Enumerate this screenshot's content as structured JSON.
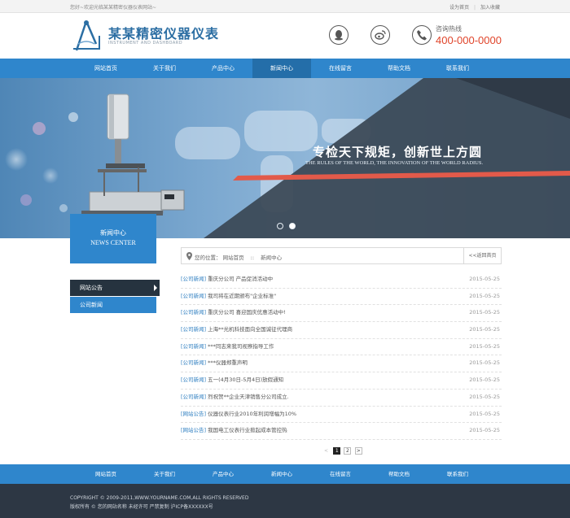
{
  "topbar": {
    "welcome": "您好~欢迎光临某某精密仪器仪表网站~",
    "set_home": "设为首页",
    "separator": "|",
    "add_favorite": "加入收藏"
  },
  "header": {
    "logo_cn": "某某精密仪器仪表",
    "logo_en": "INSTRUMENT AND DASHBOARD",
    "hotline_label": "咨询热线",
    "hotline_number": "400-000-0000"
  },
  "nav": {
    "items": [
      {
        "label": "网站首页"
      },
      {
        "label": "关于我们"
      },
      {
        "label": "产品中心"
      },
      {
        "label": "新闻中心"
      },
      {
        "label": "在线留言"
      },
      {
        "label": "帮助文档"
      },
      {
        "label": "联系我们"
      }
    ],
    "active_index": 3
  },
  "banner": {
    "slogan_cn": "专检天下规矩，创新世上方圆",
    "slogan_en": "THE RULES OF THE WORLD, THE INNOVATION OF THE WORLD RADIUS."
  },
  "sidebar": {
    "head_cn": "新闻中心",
    "head_en": "NEWS CENTER",
    "items": [
      {
        "label": "网站公告"
      },
      {
        "label": "公司新闻"
      }
    ]
  },
  "location": {
    "prefix": "您的位置：",
    "home": "网站首页",
    "separator": "::",
    "current": "新闻中心",
    "back": "<<返回首页"
  },
  "news": [
    {
      "category": "[公司新闻]",
      "title": "重庆分公司 产品促消活动中",
      "date": "2015-05-25"
    },
    {
      "category": "[公司新闻]",
      "title": "我司将在近期颁布\"企业标准\"",
      "date": "2015-05-25"
    },
    {
      "category": "[公司新闻]",
      "title": "重庆分公司 喜迎国庆优惠活动中!",
      "date": "2015-05-25"
    },
    {
      "category": "[公司新闻]",
      "title": "上海**光机科技面向全国诚征代理商",
      "date": "2015-05-25"
    },
    {
      "category": "[公司新闻]",
      "title": "***同志来我司视察指导工作",
      "date": "2015-05-25"
    },
    {
      "category": "[公司新闻]",
      "title": "***仪器郑重声明",
      "date": "2015-05-25"
    },
    {
      "category": "[公司新闻]",
      "title": "五一(4月30日-5月4日)放假通知",
      "date": "2015-05-25"
    },
    {
      "category": "[公司新闻]",
      "title": "烈祝贺**企业天津销售分公司成立.",
      "date": "2015-05-25"
    },
    {
      "category": "[网站公告]",
      "title": "仪器仪表行业2010年利润增幅为10%",
      "date": "2015-05-25"
    },
    {
      "category": "[网站公告]",
      "title": "我国电工仪表行业掀起成本管控热",
      "date": "2015-05-25"
    }
  ],
  "pager": {
    "prev": "<",
    "pages": [
      "1",
      "2"
    ],
    "next": ">"
  },
  "footer": {
    "nav": [
      {
        "label": "网站首页"
      },
      {
        "label": "关于我们"
      },
      {
        "label": "产品中心"
      },
      {
        "label": "新闻中心"
      },
      {
        "label": "在线留言"
      },
      {
        "label": "帮助文档"
      },
      {
        "label": "联系我们"
      }
    ],
    "copyright": "COPYRIGHT © 2009-2011,WWW.YOURNAME.COM,ALL RIGHTS RESERVED",
    "icp": "版权所有 © 您的网站名称 未经许可 严禁复制 沪ICP备XXXXXX号"
  },
  "colors": {
    "primary": "#2f86cc",
    "nav_active": "#246ea9",
    "dark": "#2d3744",
    "accent": "#e0442a"
  },
  "icons": {
    "qq": "qq-penguin-icon",
    "weibo": "weibo-icon",
    "phone": "phone-icon",
    "location": "location-pin-icon"
  }
}
